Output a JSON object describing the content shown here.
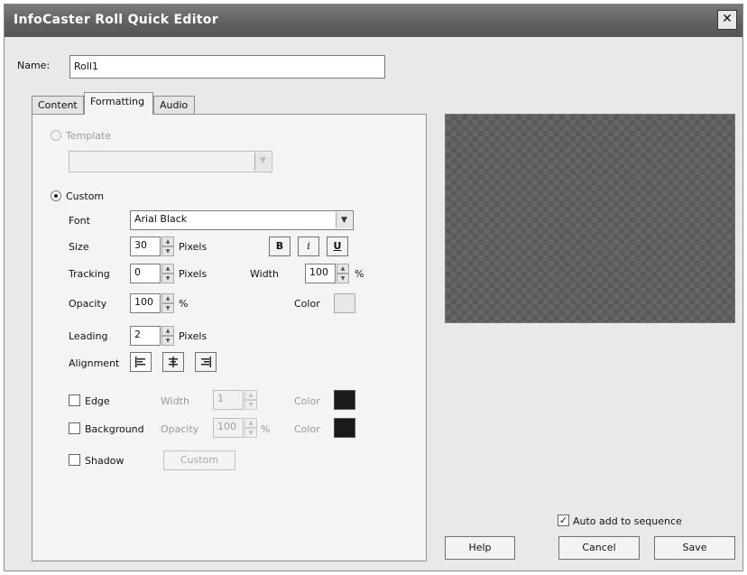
{
  "window": {
    "title": "InfoCaster Roll Quick Editor",
    "close_glyph": "✕"
  },
  "name_field": {
    "label": "Name:",
    "value": "Roll1"
  },
  "tabs": [
    {
      "label": "Content"
    },
    {
      "label": "Formatting"
    },
    {
      "label": "Audio"
    }
  ],
  "formatting": {
    "template_label": "Template",
    "template_value": "",
    "custom_label": "Custom",
    "font": {
      "label": "Font",
      "value": "Arial Black"
    },
    "size": {
      "label": "Size",
      "value": "30",
      "unit": "Pixels"
    },
    "style_buttons": {
      "bold": "B",
      "italic": "i",
      "underline": "U"
    },
    "tracking": {
      "label": "Tracking",
      "value": "0",
      "unit": "Pixels"
    },
    "width": {
      "label": "Width",
      "value": "100",
      "unit": "%"
    },
    "opacity": {
      "label": "Opacity",
      "value": "100",
      "unit": "%"
    },
    "color_label": "Color",
    "leading": {
      "label": "Leading",
      "value": "2",
      "unit": "Pixels"
    },
    "alignment_label": "Alignment",
    "edge": {
      "label": "Edge",
      "width_label": "Width",
      "width_value": "1",
      "color_label": "Color"
    },
    "background": {
      "label": "Background",
      "opacity_label": "Opacity",
      "opacity_value": "100",
      "unit": "%",
      "color_label": "Color"
    },
    "shadow": {
      "label": "Shadow",
      "button": "Custom"
    }
  },
  "colors": {
    "text_color": "#e8e8e8",
    "edge_color": "#1a1a1a",
    "background_color": "#1a1a1a"
  },
  "auto_add": {
    "label": "Auto add to sequence",
    "checked_glyph": "✓"
  },
  "buttons": {
    "help": "Help",
    "cancel": "Cancel",
    "save": "Save"
  }
}
